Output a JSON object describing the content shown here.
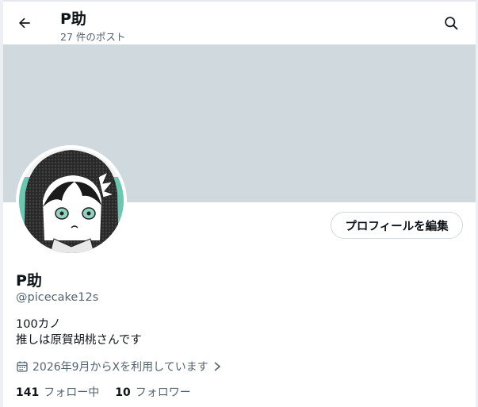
{
  "header": {
    "title": "P助",
    "subtitle": "27 件のポスト"
  },
  "icons": {
    "back": "arrow-left-icon",
    "search": "search-icon",
    "calendar": "calendar-icon",
    "chevron": "chevron-right-icon"
  },
  "colors": {
    "banner": "#cfd9de",
    "text_primary": "#0f1419",
    "text_secondary": "#536471",
    "button_border": "#cfd9de",
    "avatar_accent": "#6cc7b0"
  },
  "profile": {
    "edit_button_label": "プロフィールを編集",
    "display_name": "P助",
    "handle": "@picecake12s",
    "bio_lines": [
      "100カノ",
      "推しは原賀胡桃さんです"
    ],
    "joined": "2026年9月からXを利用しています",
    "following_count": "141",
    "following_label": "フォロー中",
    "followers_count": "10",
    "followers_label": "フォロワー"
  }
}
